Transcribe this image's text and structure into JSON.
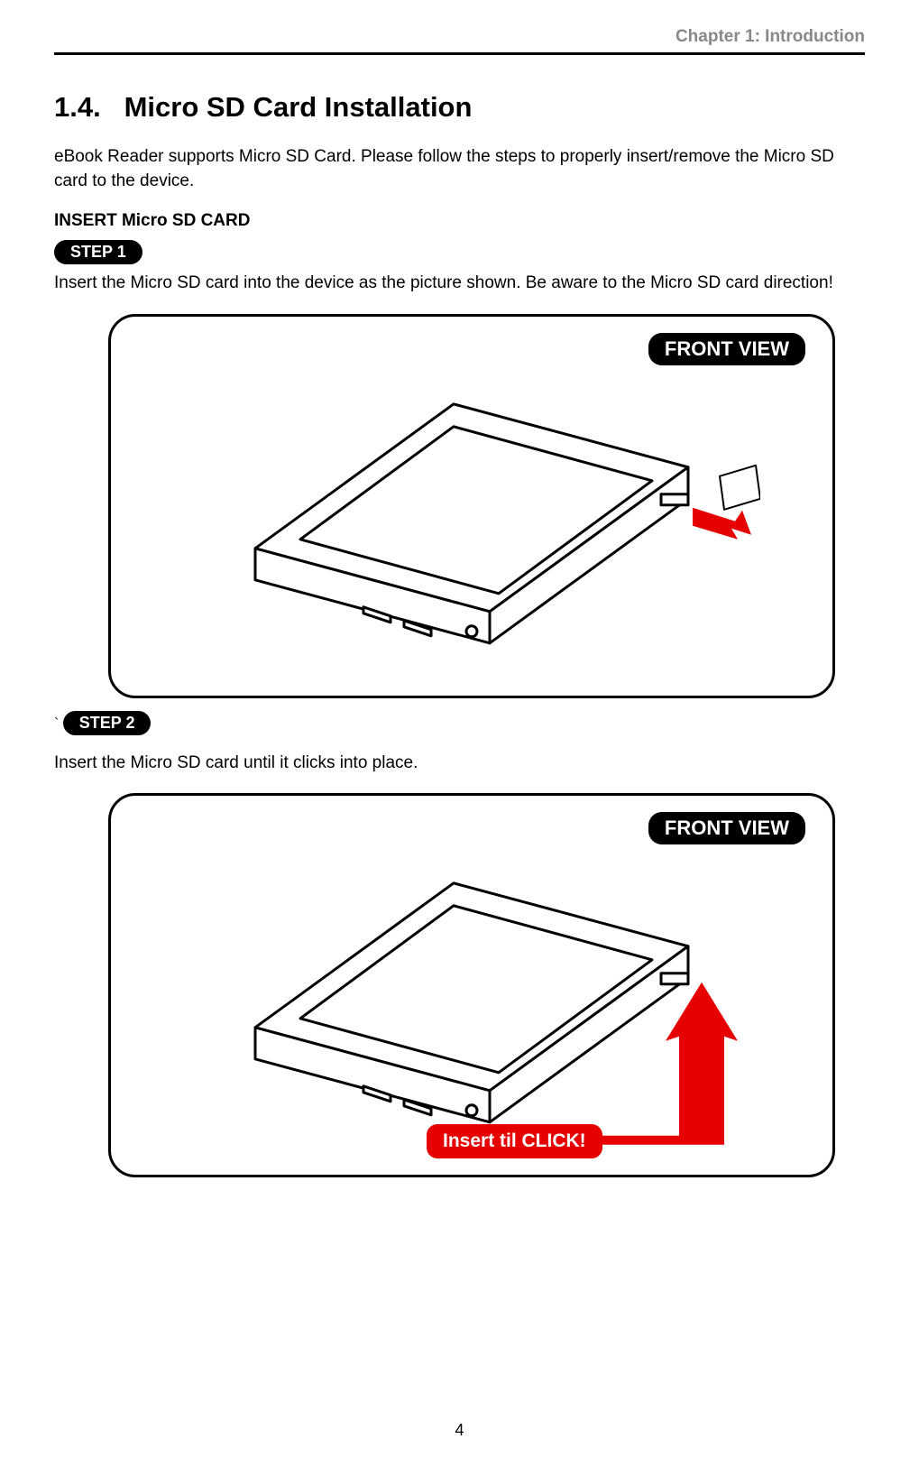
{
  "header": {
    "chapter": "Chapter 1: Introduction"
  },
  "section": {
    "number": "1.4.",
    "title": "Micro SD Card Installation",
    "intro": "eBook Reader supports Micro SD Card. Please follow the steps to properly insert/remove the Micro SD card to the device.",
    "insert_heading": "INSERT Micro SD CARD"
  },
  "steps": [
    {
      "badge": "STEP 1",
      "text": "Insert the Micro SD card into the device as the picture shown. Be aware to the Micro SD card direction!",
      "view_label": "FRONT VIEW"
    },
    {
      "badge": "STEP 2",
      "text": "Insert the Micro SD card until it clicks into place.",
      "view_label": "FRONT VIEW",
      "insert_label": "Insert til CLICK!"
    }
  ],
  "page_number": "4"
}
